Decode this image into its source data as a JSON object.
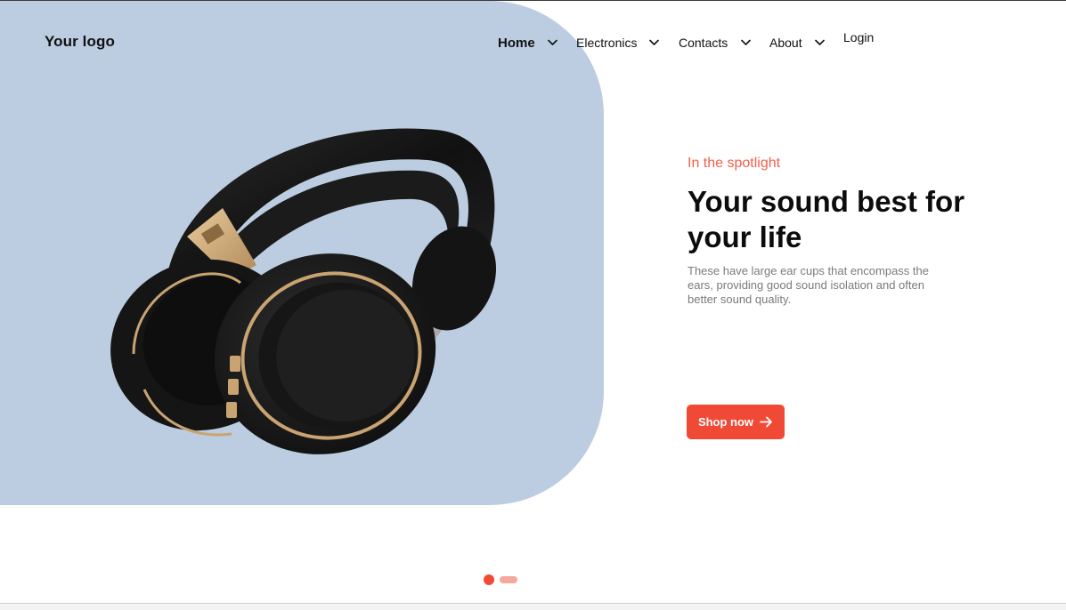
{
  "header": {
    "logo": "Your logo",
    "nav": [
      {
        "label": "Home",
        "active": true,
        "has_dropdown": true
      },
      {
        "label": "Electronics",
        "active": false,
        "has_dropdown": true
      },
      {
        "label": "Contacts",
        "active": false,
        "has_dropdown": true
      },
      {
        "label": "About",
        "active": false,
        "has_dropdown": true
      }
    ],
    "login_label": "Login"
  },
  "hero": {
    "eyebrow": "In the spotlight",
    "title": "Your sound best for your life",
    "description": "These have large ear cups that encompass the ears, providing good sound isolation and often better sound quality.",
    "cta_label": "Shop now",
    "cta_icon": "arrow-right-icon",
    "product_image": "headphones",
    "background_color": "#bccde1"
  },
  "carousel": {
    "slide_count": 2,
    "active_slide": 1
  },
  "colors": {
    "accent": "#f04a37",
    "accent_light": "#f5a89c",
    "eyebrow": "#f0604a",
    "text_primary": "#0c0c0c",
    "text_secondary": "#7b7b7b"
  }
}
